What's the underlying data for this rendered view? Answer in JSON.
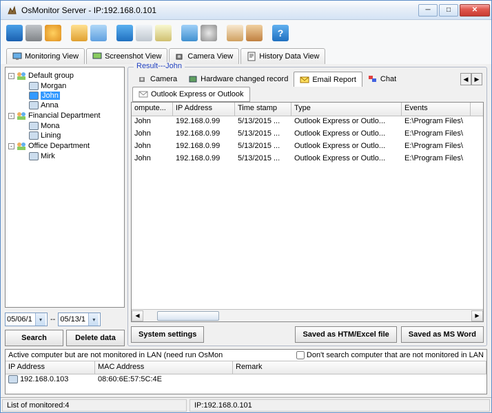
{
  "title": "OsMonitor Server  -   IP:192.168.0.101",
  "view_tabs": {
    "monitoring": "Monitoring View",
    "screenshot": "Screenshot View",
    "camera": "Camera View",
    "history": "History Data View"
  },
  "tree": {
    "groups": [
      {
        "name": "Default group",
        "expanded": true,
        "items": [
          "Morgan",
          "John",
          "Anna"
        ],
        "selected": "John"
      },
      {
        "name": "Financial Department",
        "expanded": true,
        "items": [
          "Mona",
          "Lining"
        ]
      },
      {
        "name": "Office Department",
        "expanded": true,
        "items": [
          "Mirk"
        ]
      }
    ]
  },
  "date_from": "05/06/1",
  "date_sep": "--",
  "date_to": "05/13/1",
  "search_btn": "Search",
  "delete_btn": "Delete data",
  "result_legend": "Result---John",
  "result_tabs": {
    "camera": "Camera",
    "hardware": "Hardware changed record",
    "email": "Email Report",
    "chat": "Chat"
  },
  "subtab": "Outlook Express or Outlook",
  "grid": {
    "cols": [
      "ompute...",
      "IP Address",
      "Time stamp",
      "Type",
      "Events"
    ],
    "rows": [
      [
        "John",
        "192.168.0.99",
        "5/13/2015 ...",
        "Outlook Express or Outlo...",
        "E:\\Program Files\\"
      ],
      [
        "John",
        "192.168.0.99",
        "5/13/2015 ...",
        "Outlook Express or Outlo...",
        "E:\\Program Files\\"
      ],
      [
        "John",
        "192.168.0.99",
        "5/13/2015 ...",
        "Outlook Express or Outlo...",
        "E:\\Program Files\\"
      ],
      [
        "John",
        "192.168.0.99",
        "5/13/2015 ...",
        "Outlook Express or Outlo...",
        "E:\\Program Files\\"
      ]
    ]
  },
  "bottom": {
    "system_settings": "System settings",
    "saved_htm": "Saved as HTM/Excel file",
    "saved_word": "Saved as MS Word"
  },
  "lower": {
    "msg": "Active computer but are not monitored in LAN (need run OsMon",
    "chk": "Don't search computer that are not monitored in LAN",
    "cols": [
      "IP Address",
      "MAC Address",
      "Remark"
    ],
    "row": [
      "192.168.0.103",
      "08:60:6E:57:5C:4E",
      ""
    ]
  },
  "status": {
    "monitored": "List of monitored:4",
    "ip": "IP:192.168.0.101"
  }
}
